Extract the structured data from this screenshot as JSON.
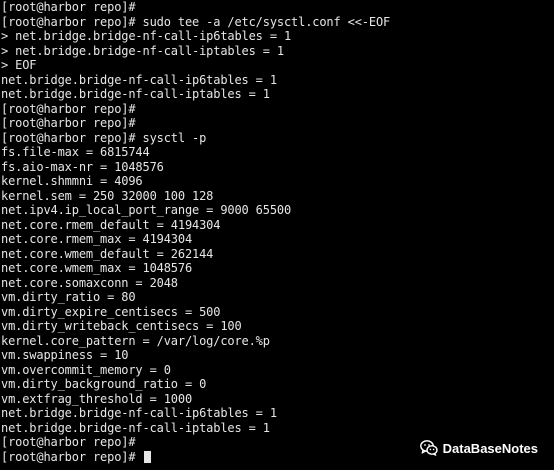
{
  "terminal": {
    "lines": [
      "[root@harbor repo]#",
      "[root@harbor repo]# sudo tee -a /etc/sysctl.conf <<-EOF",
      "> net.bridge.bridge-nf-call-ip6tables = 1",
      "> net.bridge.bridge-nf-call-iptables = 1",
      "> EOF",
      "net.bridge.bridge-nf-call-ip6tables = 1",
      "net.bridge.bridge-nf-call-iptables = 1",
      "[root@harbor repo]#",
      "[root@harbor repo]#",
      "[root@harbor repo]# sysctl -p",
      "fs.file-max = 6815744",
      "fs.aio-max-nr = 1048576",
      "kernel.shmmni = 4096",
      "kernel.sem = 250 32000 100 128",
      "net.ipv4.ip_local_port_range = 9000 65500",
      "net.core.rmem_default = 4194304",
      "net.core.rmem_max = 4194304",
      "net.core.wmem_default = 262144",
      "net.core.wmem_max = 1048576",
      "net.core.somaxconn = 2048",
      "vm.dirty_ratio = 80",
      "vm.dirty_expire_centisecs = 500",
      "vm.dirty_writeback_centisecs = 100",
      "kernel.core_pattern = /var/log/core.%p",
      "vm.swappiness = 10",
      "vm.overcommit_memory = 0",
      "vm.dirty_background_ratio = 0",
      "vm.extfrag_threshold = 1000",
      "net.bridge.bridge-nf-call-ip6tables = 1",
      "net.bridge.bridge-nf-call-iptables = 1",
      "[root@harbor repo]#",
      "[root@harbor repo]# "
    ]
  },
  "watermark": {
    "icon": "wechat-icon",
    "text": "DataBaseNotes"
  },
  "colors": {
    "background": "#000000",
    "text": "#e6e6e6",
    "watermark": "#ffffff"
  }
}
